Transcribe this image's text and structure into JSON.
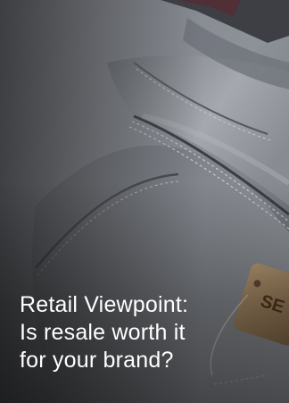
{
  "card": {
    "title_lines": [
      "Retail Viewpoint:",
      "Is resale worth it",
      "for your brand?"
    ],
    "tag_text": "SE"
  },
  "colors": {
    "denim_light": "#9a9fa6",
    "denim_dark": "#3c3f44",
    "tag": "#a88a66",
    "title_text": "#ffffff"
  }
}
